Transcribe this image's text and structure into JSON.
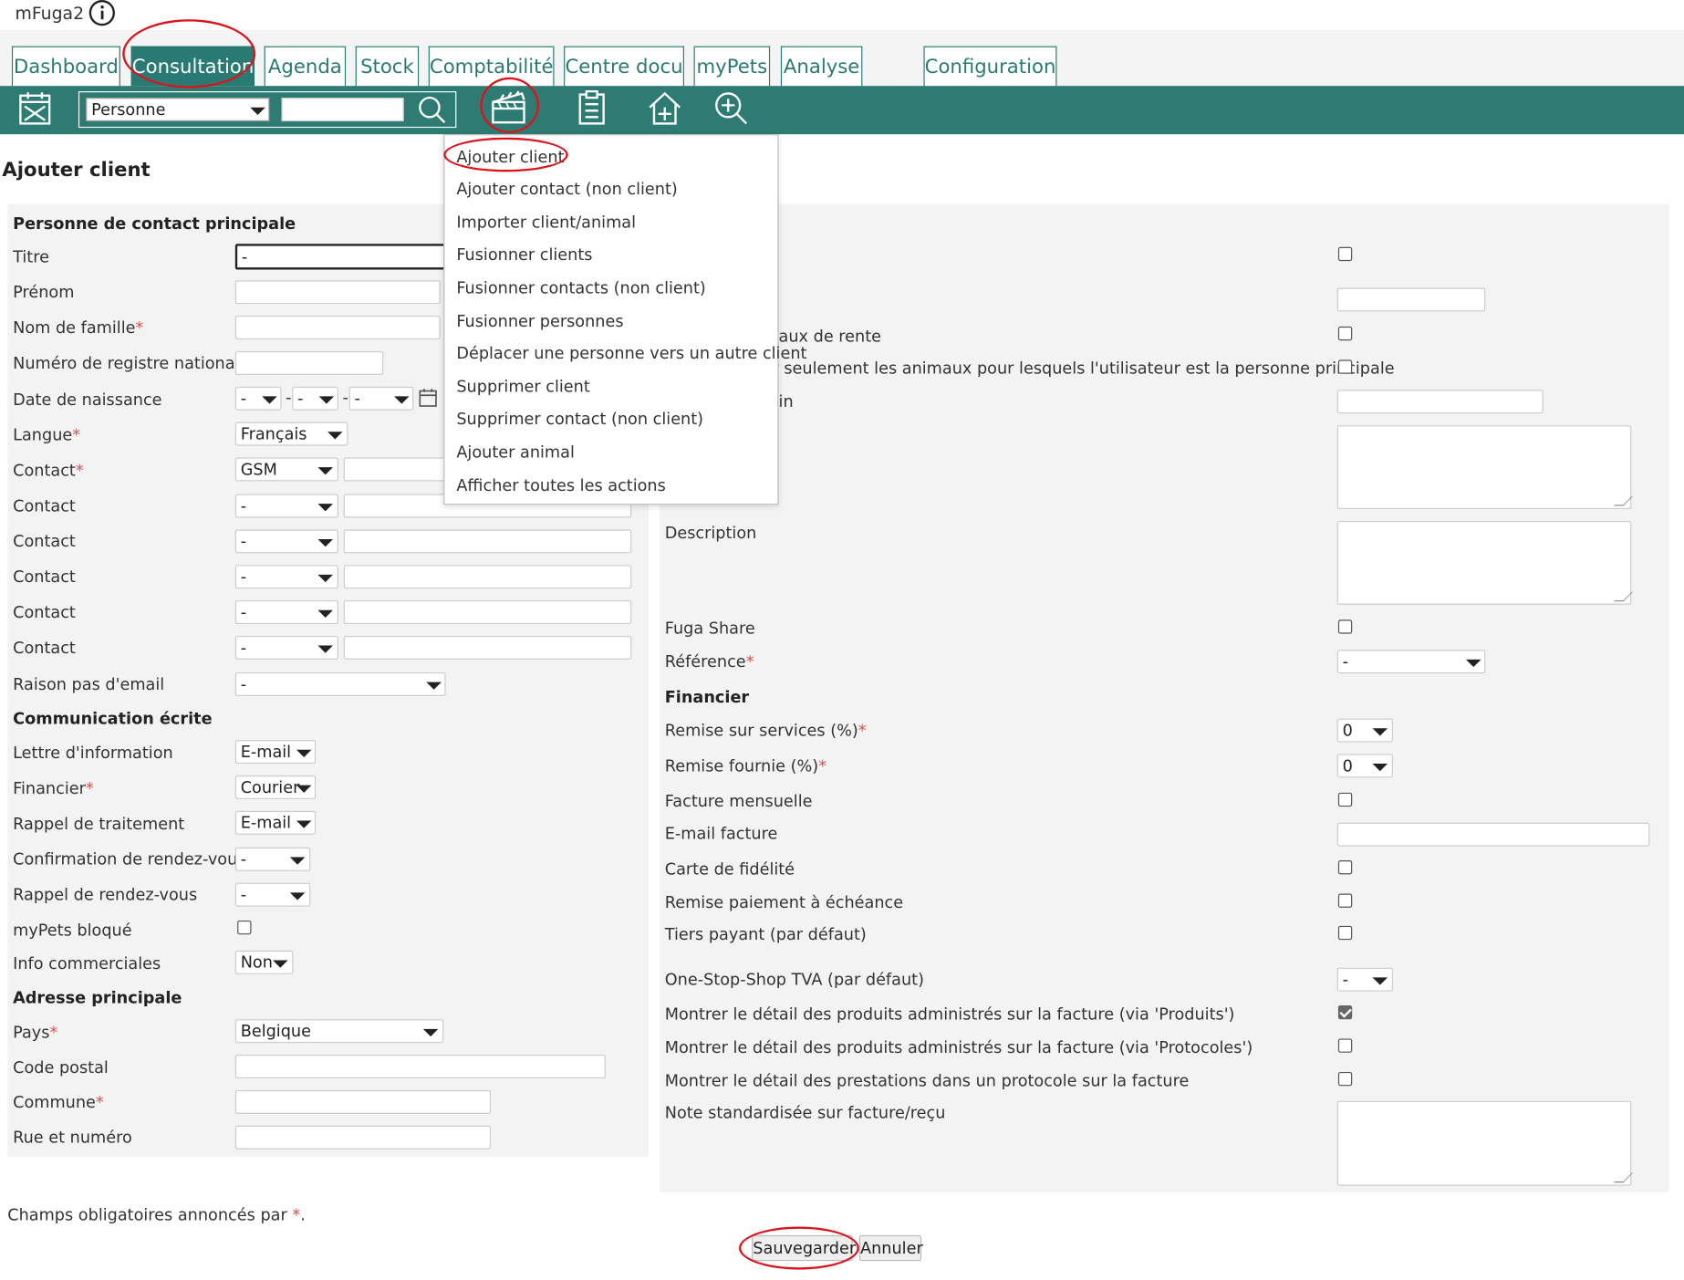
{
  "app": {
    "name": "mFuga2",
    "info_icon": "info-icon"
  },
  "tabs": [
    {
      "label": "Dashboard"
    },
    {
      "label": "Consultation"
    },
    {
      "label": "Agenda"
    },
    {
      "label": "Stock"
    },
    {
      "label": "Comptabilité"
    },
    {
      "label": "Centre docu"
    },
    {
      "label": "myPets"
    },
    {
      "label": "Analyse"
    },
    {
      "label": "Configuration"
    }
  ],
  "toolbar": {
    "search_type": "Personne",
    "search_value": "",
    "icons": [
      "calendar-icon",
      "search-icon",
      "clapperboard-icon",
      "clipboard-icon",
      "home-plus-icon",
      "zoom-in-icon"
    ]
  },
  "menu": {
    "items": [
      "Ajouter client",
      "Ajouter contact (non client)",
      "Importer client/animal",
      "Fusionner clients",
      "Fusionner contacts (non client)",
      "Fusionner personnes",
      "Déplacer une personne vers un autre client",
      "Supprimer client",
      "Supprimer contact (non client)",
      "Ajouter animal",
      "Afficher toutes les actions"
    ]
  },
  "page": {
    "title": "Ajouter client"
  },
  "left": {
    "section_contact": "Personne de contact principale",
    "titre": "Titre",
    "titre_value": "-",
    "prenom": "Prénom",
    "nom": "Nom de famille",
    "registre": "Numéro de registre national",
    "naissance": "Date de naissance",
    "date_day": "-",
    "date_month": "-",
    "date_year": "-",
    "date_sep": "-",
    "langue": "Langue",
    "langue_value": "Français",
    "contact": "Contact",
    "contact_first": "GSM",
    "contact_other": "-",
    "raison_email": "Raison pas d'email",
    "raison_email_value": "-",
    "section_comm": "Communication écrite",
    "lettre": "Lettre d'information",
    "lettre_value": "E-mail",
    "financier": "Financier",
    "financier_value": "Courier",
    "rappel_traitement": "Rappel de traitement",
    "rappel_traitement_value": "E-mail",
    "confirmation_rdv": "Confirmation de rendez-vous",
    "confirmation_rdv_value": "-",
    "rappel_rdv": "Rappel de rendez-vous",
    "rappel_rdv_value": "-",
    "mypets_bloque": "myPets bloqué",
    "info_comm": "Info commerciales",
    "info_comm_value": "Non",
    "section_adresse": "Adresse principale",
    "pays": "Pays",
    "pays_value": "Belgique",
    "code_postal": "Code postal",
    "commune": "Commune",
    "rue": "Rue et numéro",
    "required_mark": "*"
  },
  "right": {
    "frag_rente": "aux de rente",
    "frag_animaux": "r seulement les animaux pour lesquels l'utilisateur est la personne principale",
    "frag_in": "in",
    "description": "Description",
    "fuga_share": "Fuga Share",
    "reference": "Référence",
    "reference_value": "-",
    "section_financier": "Financier",
    "remise_services": "Remise sur services (%)",
    "remise_services_value": "0",
    "remise_fournie": "Remise fournie (%)",
    "remise_fournie_value": "0",
    "facture_mensuelle": "Facture mensuelle",
    "email_facture": "E-mail facture",
    "carte_fidelite": "Carte de fidélité",
    "remise_paiement": "Remise paiement à échéance",
    "tiers_payant": "Tiers payant (par défaut)",
    "oss_tva": "One-Stop-Shop TVA (par défaut)",
    "oss_tva_value": "-",
    "detail_produits": "Montrer le détail des produits administrés sur la facture (via 'Produits')",
    "detail_protocoles": "Montrer le détail des produits administrés sur la facture (via 'Protocoles')",
    "detail_prestations": "Montrer le détail des prestations dans un protocole sur la facture",
    "note_facture": "Note standardisée sur facture/reçu"
  },
  "footer": {
    "note_prefix": "Champs obligatoires annoncés par ",
    "note_star": "*",
    "note_suffix": ".",
    "save": "Sauvegarder",
    "cancel": "Annuler"
  },
  "colors": {
    "accent": "#2e7b74",
    "required": "#d9534f",
    "annotation": "#d9141c"
  }
}
